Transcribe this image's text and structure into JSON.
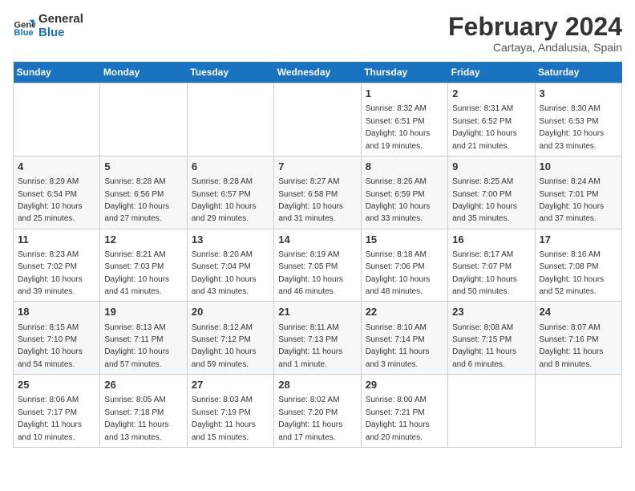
{
  "logo": {
    "line1": "General",
    "line2": "Blue"
  },
  "title": "February 2024",
  "subtitle": "Cartaya, Andalusia, Spain",
  "weekdays": [
    "Sunday",
    "Monday",
    "Tuesday",
    "Wednesday",
    "Thursday",
    "Friday",
    "Saturday"
  ],
  "weeks": [
    [
      {
        "day": "",
        "detail": ""
      },
      {
        "day": "",
        "detail": ""
      },
      {
        "day": "",
        "detail": ""
      },
      {
        "day": "",
        "detail": ""
      },
      {
        "day": "1",
        "detail": "Sunrise: 8:32 AM\nSunset: 6:51 PM\nDaylight: 10 hours\nand 19 minutes."
      },
      {
        "day": "2",
        "detail": "Sunrise: 8:31 AM\nSunset: 6:52 PM\nDaylight: 10 hours\nand 21 minutes."
      },
      {
        "day": "3",
        "detail": "Sunrise: 8:30 AM\nSunset: 6:53 PM\nDaylight: 10 hours\nand 23 minutes."
      }
    ],
    [
      {
        "day": "4",
        "detail": "Sunrise: 8:29 AM\nSunset: 6:54 PM\nDaylight: 10 hours\nand 25 minutes."
      },
      {
        "day": "5",
        "detail": "Sunrise: 8:28 AM\nSunset: 6:56 PM\nDaylight: 10 hours\nand 27 minutes."
      },
      {
        "day": "6",
        "detail": "Sunrise: 8:28 AM\nSunset: 6:57 PM\nDaylight: 10 hours\nand 29 minutes."
      },
      {
        "day": "7",
        "detail": "Sunrise: 8:27 AM\nSunset: 6:58 PM\nDaylight: 10 hours\nand 31 minutes."
      },
      {
        "day": "8",
        "detail": "Sunrise: 8:26 AM\nSunset: 6:59 PM\nDaylight: 10 hours\nand 33 minutes."
      },
      {
        "day": "9",
        "detail": "Sunrise: 8:25 AM\nSunset: 7:00 PM\nDaylight: 10 hours\nand 35 minutes."
      },
      {
        "day": "10",
        "detail": "Sunrise: 8:24 AM\nSunset: 7:01 PM\nDaylight: 10 hours\nand 37 minutes."
      }
    ],
    [
      {
        "day": "11",
        "detail": "Sunrise: 8:23 AM\nSunset: 7:02 PM\nDaylight: 10 hours\nand 39 minutes."
      },
      {
        "day": "12",
        "detail": "Sunrise: 8:21 AM\nSunset: 7:03 PM\nDaylight: 10 hours\nand 41 minutes."
      },
      {
        "day": "13",
        "detail": "Sunrise: 8:20 AM\nSunset: 7:04 PM\nDaylight: 10 hours\nand 43 minutes."
      },
      {
        "day": "14",
        "detail": "Sunrise: 8:19 AM\nSunset: 7:05 PM\nDaylight: 10 hours\nand 46 minutes."
      },
      {
        "day": "15",
        "detail": "Sunrise: 8:18 AM\nSunset: 7:06 PM\nDaylight: 10 hours\nand 48 minutes."
      },
      {
        "day": "16",
        "detail": "Sunrise: 8:17 AM\nSunset: 7:07 PM\nDaylight: 10 hours\nand 50 minutes."
      },
      {
        "day": "17",
        "detail": "Sunrise: 8:16 AM\nSunset: 7:08 PM\nDaylight: 10 hours\nand 52 minutes."
      }
    ],
    [
      {
        "day": "18",
        "detail": "Sunrise: 8:15 AM\nSunset: 7:10 PM\nDaylight: 10 hours\nand 54 minutes."
      },
      {
        "day": "19",
        "detail": "Sunrise: 8:13 AM\nSunset: 7:11 PM\nDaylight: 10 hours\nand 57 minutes."
      },
      {
        "day": "20",
        "detail": "Sunrise: 8:12 AM\nSunset: 7:12 PM\nDaylight: 10 hours\nand 59 minutes."
      },
      {
        "day": "21",
        "detail": "Sunrise: 8:11 AM\nSunset: 7:13 PM\nDaylight: 11 hours\nand 1 minute."
      },
      {
        "day": "22",
        "detail": "Sunrise: 8:10 AM\nSunset: 7:14 PM\nDaylight: 11 hours\nand 3 minutes."
      },
      {
        "day": "23",
        "detail": "Sunrise: 8:08 AM\nSunset: 7:15 PM\nDaylight: 11 hours\nand 6 minutes."
      },
      {
        "day": "24",
        "detail": "Sunrise: 8:07 AM\nSunset: 7:16 PM\nDaylight: 11 hours\nand 8 minutes."
      }
    ],
    [
      {
        "day": "25",
        "detail": "Sunrise: 8:06 AM\nSunset: 7:17 PM\nDaylight: 11 hours\nand 10 minutes."
      },
      {
        "day": "26",
        "detail": "Sunrise: 8:05 AM\nSunset: 7:18 PM\nDaylight: 11 hours\nand 13 minutes."
      },
      {
        "day": "27",
        "detail": "Sunrise: 8:03 AM\nSunset: 7:19 PM\nDaylight: 11 hours\nand 15 minutes."
      },
      {
        "day": "28",
        "detail": "Sunrise: 8:02 AM\nSunset: 7:20 PM\nDaylight: 11 hours\nand 17 minutes."
      },
      {
        "day": "29",
        "detail": "Sunrise: 8:00 AM\nSunset: 7:21 PM\nDaylight: 11 hours\nand 20 minutes."
      },
      {
        "day": "",
        "detail": ""
      },
      {
        "day": "",
        "detail": ""
      }
    ]
  ]
}
